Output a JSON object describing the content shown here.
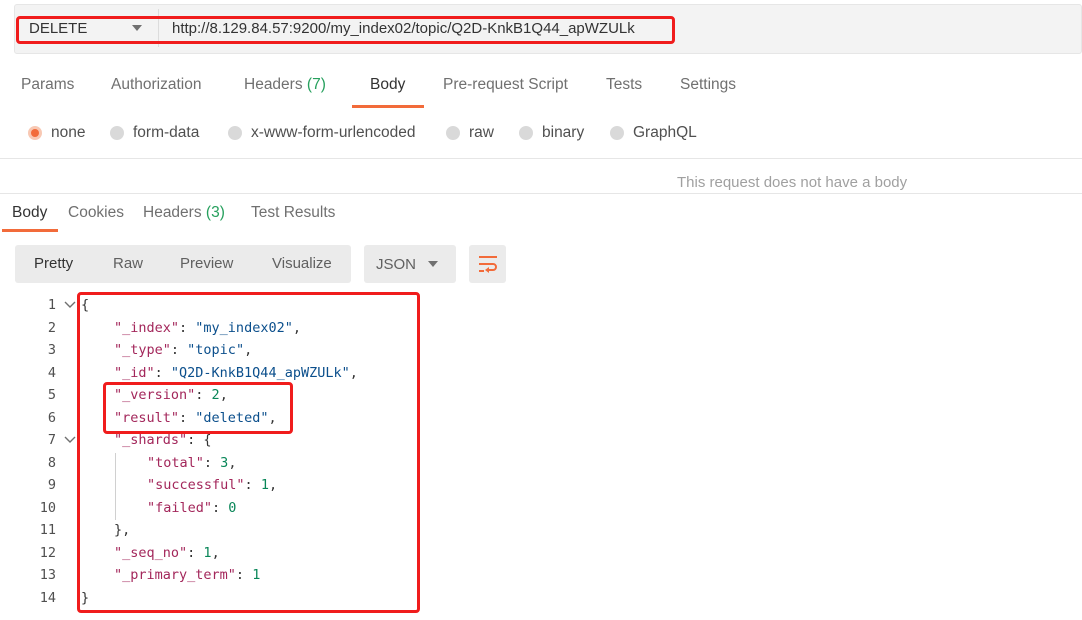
{
  "request": {
    "method": "DELETE",
    "url": "http://8.129.84.57:9200/my_index02/topic/Q2D-KnkB1Q44_apWZULk"
  },
  "request_tabs": [
    {
      "label": "Params",
      "count": ""
    },
    {
      "label": "Authorization",
      "count": ""
    },
    {
      "label": "Headers",
      "count": "(7)"
    },
    {
      "label": "Body",
      "count": ""
    },
    {
      "label": "Pre-request Script",
      "count": ""
    },
    {
      "label": "Tests",
      "count": ""
    },
    {
      "label": "Settings",
      "count": ""
    }
  ],
  "active_request_tab": "Body",
  "body_types": [
    "none",
    "form-data",
    "x-www-form-urlencoded",
    "raw",
    "binary",
    "GraphQL"
  ],
  "selected_body_type": "none",
  "no_body_message": "This request does not have a body",
  "response_tabs": [
    {
      "label": "Body",
      "count": ""
    },
    {
      "label": "Cookies",
      "count": ""
    },
    {
      "label": "Headers",
      "count": "(3)"
    },
    {
      "label": "Test Results",
      "count": ""
    }
  ],
  "active_response_tab": "Body",
  "view_modes": [
    "Pretty",
    "Raw",
    "Preview",
    "Visualize"
  ],
  "active_view_mode": "Pretty",
  "format": "JSON",
  "icons": {
    "wrap": "wrap-lines-icon",
    "caret": "chevron-down-icon",
    "fold": "fold-arrow-icon"
  },
  "colors": {
    "accent": "#f26b3a",
    "count": "#26a05d",
    "highlight_box": "#f01c1c"
  },
  "response_lines": [
    {
      "n": "1",
      "text": "{"
    },
    {
      "n": "2",
      "text": "\"_index\": \"my_index02\","
    },
    {
      "n": "3",
      "text": "\"_type\": \"topic\","
    },
    {
      "n": "4",
      "text": "\"_id\": \"Q2D-KnkB1Q44_apWZULk\","
    },
    {
      "n": "5",
      "text": "\"_version\": 2,"
    },
    {
      "n": "6",
      "text": "\"result\": \"deleted\","
    },
    {
      "n": "7",
      "text": "\"_shards\": {"
    },
    {
      "n": "8",
      "text": "\"total\": 3,"
    },
    {
      "n": "9",
      "text": "\"successful\": 1,"
    },
    {
      "n": "10",
      "text": "\"failed\": 0"
    },
    {
      "n": "11",
      "text": "},"
    },
    {
      "n": "12",
      "text": "\"_seq_no\": 1,"
    },
    {
      "n": "13",
      "text": "\"_primary_term\": 1"
    },
    {
      "n": "14",
      "text": "}"
    }
  ]
}
